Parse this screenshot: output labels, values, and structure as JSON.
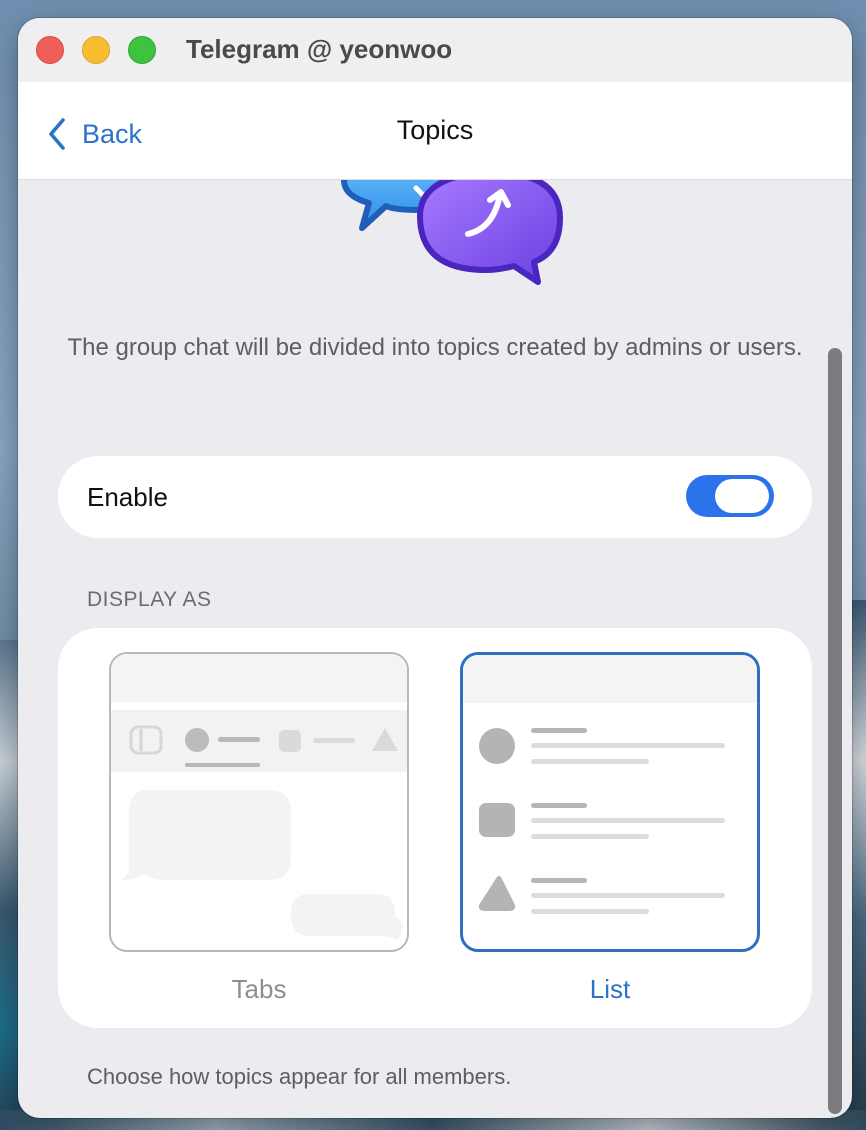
{
  "window": {
    "title": "Telegram @ yeonwoo"
  },
  "navbar": {
    "back_label": "Back",
    "title": "Topics"
  },
  "hero": {
    "icon": "topics-chat-bubbles-icon"
  },
  "description": "The group chat will be divided into topics created by admins or users.",
  "enable": {
    "label": "Enable",
    "enabled": true
  },
  "display_as": {
    "header": "DISPLAY AS",
    "options": [
      {
        "label": "Tabs",
        "selected": false
      },
      {
        "label": "List",
        "selected": true
      }
    ],
    "footer": "Choose how topics appear for all members."
  },
  "colors": {
    "accent": "#2a73c7",
    "toggle_on": "#2a73e8",
    "background": "#ebebf0",
    "card": "#ffffff"
  }
}
